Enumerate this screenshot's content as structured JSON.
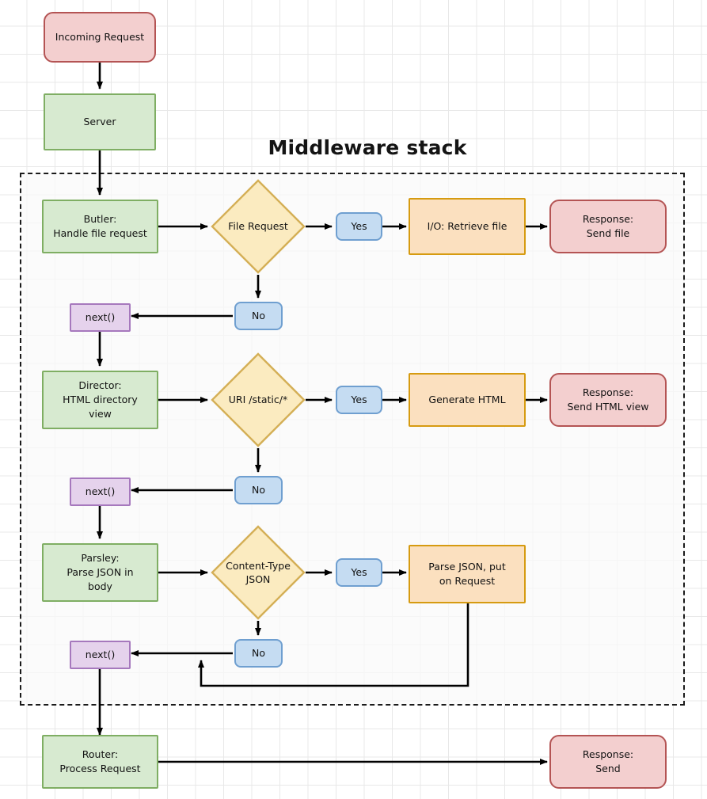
{
  "diagram": {
    "title": "Middleware stack",
    "region_label": "Middleware stack"
  },
  "nodes": {
    "incoming_request": "Incoming Request",
    "server": "Server",
    "butler": "Butler:\nHandle file request",
    "file_request": "File Request",
    "yes_1": "Yes",
    "io_retrieve_file": "I/O: Retrieve file",
    "response_send_file": "Response:\nSend file",
    "no_1": "No",
    "next_1": "next()",
    "director": "Director:\nHTML directory\nview",
    "uri_static": "URI /static/*",
    "yes_2": "Yes",
    "generate_html": "Generate HTML",
    "response_send_html": "Response:\nSend HTML view",
    "no_2": "No",
    "next_2": "next()",
    "parsley": "Parsley:\nParse JSON in\nbody",
    "content_type_json": "Content-Type\nJSON",
    "yes_3": "Yes",
    "parse_json_put": "Parse JSON, put\non Request",
    "no_3": "No",
    "next_3": "next()",
    "router": "Router:\nProcess Request",
    "response_send": "Response:\nSend"
  },
  "colors": {
    "red_fill": "#f3cfcf",
    "red_stroke": "#b45454",
    "green_fill": "#d7ead0",
    "green_stroke": "#7fae63",
    "blue_fill": "#c5dcf2",
    "blue_stroke": "#6f9fd0",
    "orange_fill": "#fbe0bf",
    "orange_stroke": "#d69b11",
    "yellow_fill": "#fbebc0",
    "yellow_stroke": "#d4af56",
    "purple_fill": "#e5d2ec",
    "purple_stroke": "#a678bd",
    "edge": "#000000",
    "grid": "#e8e8e8"
  }
}
